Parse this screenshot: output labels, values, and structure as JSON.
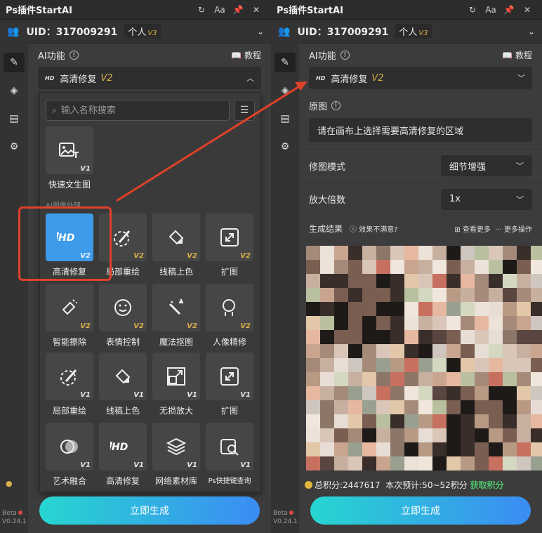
{
  "app": {
    "title": "Ps插件StartAI",
    "icons": [
      "refresh-icon",
      "font-size-icon",
      "pin-icon",
      "close-icon"
    ],
    "font_button": "Aa",
    "uid_label": "UID：317009291",
    "plan": "个人",
    "plan_badge": "V3",
    "version": "Beta",
    "version_number": "V0.24.1",
    "sidebar_icons": [
      "pen-icon",
      "layers-icon",
      "clipboard-icon",
      "gear-icon"
    ]
  },
  "left": {
    "section_title": "AI功能",
    "tutorial": "教程",
    "feature": "高清修复",
    "feature_version": "V2",
    "search_placeholder": "输入名称搜索",
    "first_tile": {
      "label": "快速文生图",
      "version": "V1"
    },
    "group_label": "AI图像处理",
    "tiles": [
      {
        "label": "高清修复",
        "version": "V2",
        "icon": "hd-icon",
        "active": true
      },
      {
        "label": "局部重绘",
        "version": "V2",
        "icon": "brush-icon"
      },
      {
        "label": "线稿上色",
        "version": "V2",
        "icon": "paint-bucket-icon"
      },
      {
        "label": "扩图",
        "version": "V2",
        "icon": "expand-icon"
      },
      {
        "label": "智能擦除",
        "version": "V2",
        "icon": "eraser-icon"
      },
      {
        "label": "表情控制",
        "version": "V2",
        "icon": "smile-icon"
      },
      {
        "label": "魔法抠图",
        "version": "V2",
        "icon": "magic-wand-icon"
      },
      {
        "label": "人像精修",
        "version": "V2",
        "icon": "portrait-icon"
      },
      {
        "label": "局部重绘",
        "version": "V1",
        "icon": "brush-icon"
      },
      {
        "label": "线稿上色",
        "version": "V1",
        "icon": "paint-bucket-icon"
      },
      {
        "label": "无损放大",
        "version": "V1",
        "icon": "upscale-icon"
      },
      {
        "label": "扩图",
        "version": "V1",
        "icon": "expand-icon"
      },
      {
        "label": "艺术融合",
        "version": "V1",
        "icon": "art-blend-icon"
      },
      {
        "label": "高清修复",
        "version": "V1",
        "icon": "hd-icon"
      },
      {
        "label": "网络素材库",
        "version": "V1",
        "icon": "stack-icon"
      },
      {
        "label": "Ps快捷键查询",
        "version": "V1",
        "icon": "shortcut-search-icon"
      }
    ],
    "generate": "立即生成"
  },
  "right": {
    "section_title": "AI功能",
    "tutorial": "教程",
    "feature": "高清修复",
    "feature_version": "V2",
    "original_label": "原图",
    "original_hint": "请在画布上选择需要高清修复的区域",
    "mode_label": "修图模式",
    "mode_value": "细节增强",
    "scale_label": "放大倍数",
    "scale_value": "1x",
    "result_label": "生成结果",
    "unsatisfied": "效果不满意?",
    "view_more": "查看更多",
    "more_ops": "更多操作",
    "total_points": "总积分:2447617",
    "estimate": "本次预计:50~52积分",
    "earn": "获取积分",
    "generate": "立即生成"
  },
  "colors": {
    "accent_gradient_start": "#27d6d0",
    "accent_gradient_end": "#3b8cf4",
    "version_gold": "#d8b04a",
    "highlight_red": "#e0412a",
    "active_tile": "#3d9be9",
    "earn_green": "#4fc36b"
  }
}
